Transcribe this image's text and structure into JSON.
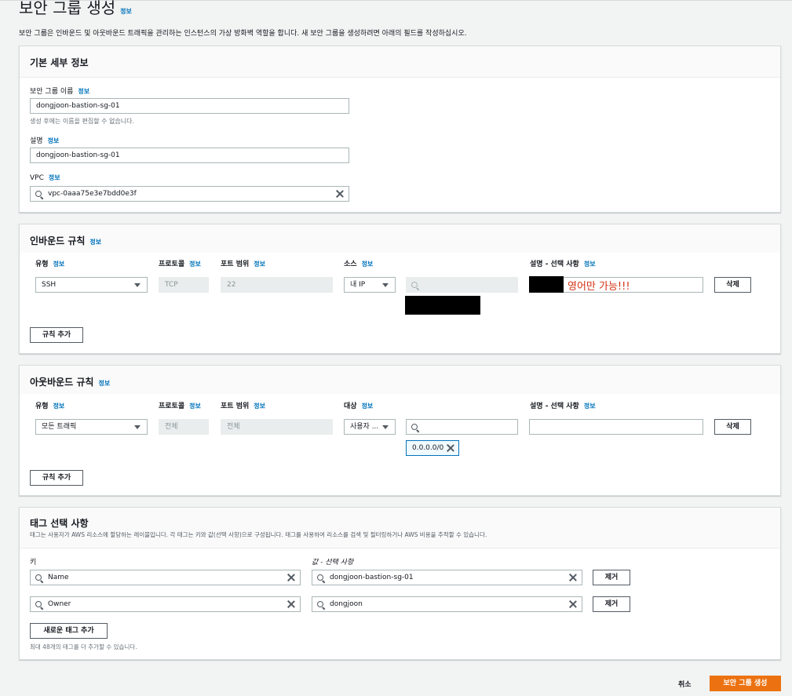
{
  "page": {
    "title": "보안 그룹 생성",
    "info": "정보",
    "description": "보안 그룹은 인바운드 및 아웃바운드 트래픽을 관리하는 인스턴스의 가상 방화벽 역할을 합니다. 새 보안 그룹을 생성하려면 아래의 필드를 작성하십시오."
  },
  "basic": {
    "title": "기본 세부 정보",
    "name_label": "보안 그룹 이름",
    "name_value": "dongjoon-bastion-sg-01",
    "name_hint": "생성 후에는 이름을 편집할 수 없습니다.",
    "desc_label": "설명",
    "desc_value": "dongjoon-bastion-sg-01",
    "vpc_label": "VPC",
    "vpc_value": "vpc-0aaa75e3e7bdd0e3f",
    "info": "정보"
  },
  "inbound": {
    "title": "인바운드 규칙",
    "info": "정보",
    "col_type": "유형",
    "col_protocol": "프로토콜",
    "col_port": "포트 범위",
    "col_source": "소스",
    "col_desc": "설명 - 선택 사항",
    "type_value": "SSH",
    "protocol_value": "TCP",
    "port_value": "22",
    "source_value": "내 IP",
    "annotation": "영어만 가능!!!",
    "delete_label": "삭제",
    "add_rule_label": "규칙 추가"
  },
  "outbound": {
    "title": "아웃바운드 규칙",
    "info": "정보",
    "col_type": "유형",
    "col_protocol": "프로토콜",
    "col_port": "포트 범위",
    "col_dest": "대상",
    "col_desc": "설명 - 선택 사항",
    "type_value": "모든 트래픽",
    "protocol_value": "전체",
    "port_value": "전체",
    "dest_value": "사용자 ...",
    "cidr_token": "0.0.0.0/0",
    "delete_label": "삭제",
    "add_rule_label": "규칙 추가"
  },
  "tags": {
    "title": "태그 선택 사항",
    "description": "태그는 사용자가 AWS 리소스에 할당하는 레이블입니다. 각 태그는 키와 값(선택 사항)으로 구성됩니다. 태그를 사용하여 리소스를 검색 및 필터링하거나 AWS 비용을 추적할 수 있습니다.",
    "key_label": "키",
    "value_label": "값 - 선택 사항",
    "rows": [
      {
        "key": "Name",
        "value": "dongjoon-bastion-sg-01",
        "remove": "제거"
      },
      {
        "key": "Owner",
        "value": "dongjoon",
        "remove": "제거"
      }
    ],
    "add_tag_label": "새로운 태그 추가",
    "limit_hint": "최대 48개의 태그를 더 추가할 수 있습니다."
  },
  "footer": {
    "cancel_label": "취소",
    "create_label": "보안 그룹 생성"
  },
  "colors": {
    "primary": "#ec7211",
    "link": "#0073bb",
    "annotation": "#d13212"
  }
}
